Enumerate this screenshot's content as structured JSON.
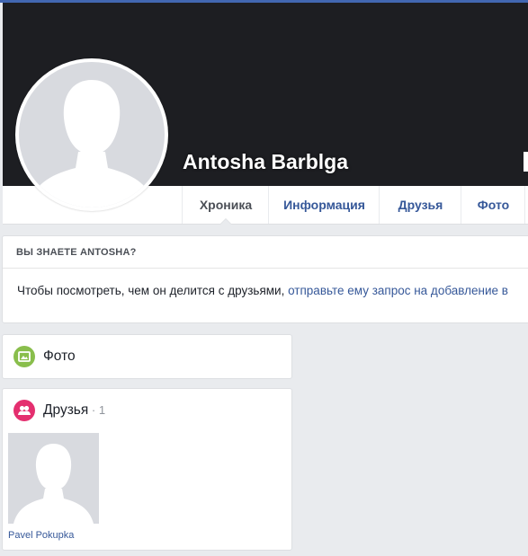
{
  "profile": {
    "name": "Antosha Barblga"
  },
  "tabs": [
    {
      "label": "Хроника",
      "active": true
    },
    {
      "label": "Информация",
      "active": false
    },
    {
      "label": "Друзья",
      "active": false
    },
    {
      "label": "Фото",
      "active": false
    }
  ],
  "know_card": {
    "title": "ВЫ ЗНАЕТЕ ANTOSHA?",
    "text": "Чтобы посмотреть, чем он делится с друзьями, ",
    "link": "отправьте ему запрос на добавление в"
  },
  "photos_section": {
    "title": "Фото",
    "icon": "photo-icon"
  },
  "friends_section": {
    "title": "Друзья",
    "count": " · 1",
    "icon": "friends-icon",
    "items": [
      {
        "name": "Pavel Pokupka"
      }
    ]
  },
  "colors": {
    "topbar": "#4267b2",
    "cover": "#1d1e22",
    "link": "#365899",
    "photo_icon": "#89be4c",
    "friends_icon": "#e42f6f",
    "placeholder": "#d8dadf"
  }
}
